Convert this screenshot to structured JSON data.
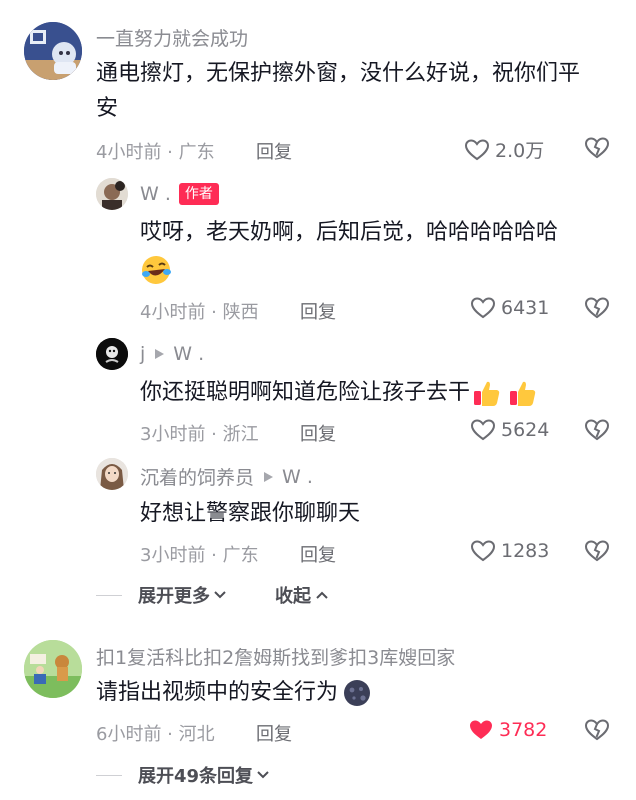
{
  "comments": [
    {
      "username": "一直努力就会成功",
      "text_line1": "通电擦灯，无保护擦外窗，没什么好说，祝你们平",
      "text_line2": "安",
      "time_location": "4小时前 · 广东",
      "reply_label": "回复",
      "like_count": "2.0万",
      "liked": false
    },
    {
      "username": "W .",
      "badge": "作者",
      "text": "哎呀，老天奶啊，后知后觉，哈哈哈哈哈哈",
      "emoji": "laughing-crying-emoji",
      "time_location": "4小时前 · 陕西",
      "reply_label": "回复",
      "like_count": "6431",
      "liked": false
    },
    {
      "username": "j",
      "reply_to": "W .",
      "text": "你还挺聪明啊知道危险让孩子去干",
      "emoji": "thumbs-up-emoji",
      "time_location": "3小时前 · 浙江",
      "reply_label": "回复",
      "like_count": "5624",
      "liked": false
    },
    {
      "username": "沉着的饲养员",
      "reply_to": "W .",
      "text": "好想让警察跟你聊聊天",
      "time_location": "3小时前 · 广东",
      "reply_label": "回复",
      "like_count": "1283",
      "liked": false
    },
    {
      "username": "扣1复活科比扣2詹姆斯找到爹扣3库嫂回家",
      "text": "请指出视频中的安全行为",
      "emoji": "dark-moon-face-emoji",
      "time_location": "6小时前 · 河北",
      "reply_label": "回复",
      "like_count": "3782",
      "liked": true
    }
  ],
  "thread_controls": {
    "expand_more": "展开更多",
    "collapse": "收起",
    "expand_replies": "展开49条回复"
  },
  "colors": {
    "accent": "#fe2c55",
    "text": "#161823",
    "meta": "#9a9ba1"
  }
}
